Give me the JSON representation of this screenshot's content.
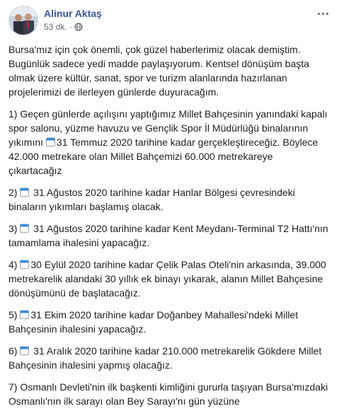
{
  "post": {
    "author": "Alinur Aktaş",
    "time": "53 dk.",
    "separator": "·",
    "paragraphs": [
      {
        "icon": false,
        "text": "Bursa'mız için çok önemli, çok güzel haberlerimiz olacak demiştim. Bugünlük sadece yedi madde paylaşıyorum. Kentsel dönüşüm başta olmak üzere kültür, sanat, spor ve turizm alanlarında hazırlanan projelerimizi de ilerleyen günlerde duyuracağım."
      },
      {
        "icon": false,
        "pre": "1) Geçen günlerde açılışını yaptığımız Millet Bahçesinin yanındaki kapalı spor salonu, yüzme havuzu ve Gençlik Spor İl Müdürlüğü binalarının yıkımını ",
        "mid_icon": true,
        "text": "31 Temmuz 2020 tarihine kadar gerçekleştireceğiz. Böylece 42.000 metrekare olan Millet Bahçemizi 60.000 metrekareye çıkartacağız"
      },
      {
        "icon": true,
        "pre": "2) ",
        "text": " 31 Ağustos 2020 tarihine kadar Hanlar Bölgesi çevresindeki binaların yıkımları başlamış olacak."
      },
      {
        "icon": true,
        "pre": "3) ",
        "text": " 31 Ağustos 2020 tarihine kadar Kent Meydanı-Terminal T2 Hattı'nın tamamlama ihalesini yapacağız."
      },
      {
        "icon": true,
        "pre": "4) ",
        "text": "30 Eylül 2020 tarihine kadar Çelik Palas Oteli'nin arkasında, 39.000 metrekarelik alandaki 30 yıllık ek binayı yıkarak, alanın Millet Bahçesine dönüşümünü de başlatacağız."
      },
      {
        "icon": true,
        "pre": "5) ",
        "text": "31 Ekim 2020 tarihine kadar Doğanbey Mahallesi'ndeki Millet Bahçesinin ihalesini yapacağız."
      },
      {
        "icon": true,
        "pre": "6) ",
        "text": " 31 Aralık 2020 tarihine kadar 210.000 metrekarelik Gökdere Millet Bahçesinin ihalesini yapmış olacağız."
      },
      {
        "icon": false,
        "text": "7) Osmanlı Devleti'nin ilk başkenti kimliğini gururla taşıyan Bursa'mızdaki Osmanlı'nın ilk sarayı olan Bey Sarayı'nı gün yüzüne"
      }
    ]
  }
}
